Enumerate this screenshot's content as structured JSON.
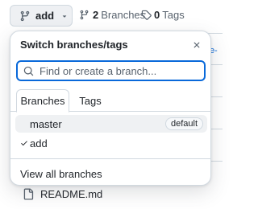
{
  "header": {
    "branch_button_label": "add",
    "branches_count": "2",
    "branches_word": "Branches",
    "tags_count": "0",
    "tags_word": "Tags",
    "bg_link_fragment": "ive-"
  },
  "panel": {
    "title": "Switch branches/tags",
    "search": {
      "placeholder": "Find or create a branch...",
      "value": ""
    },
    "tabs": [
      {
        "label": "Branches",
        "active": true
      },
      {
        "label": "Tags",
        "active": false
      }
    ],
    "items": [
      {
        "name": "master",
        "badge": "default",
        "selected": false,
        "highlighted": true
      },
      {
        "name": "add",
        "badge": "",
        "selected": true,
        "highlighted": false
      }
    ],
    "view_all": "View all branches"
  },
  "file": {
    "name": "README.md"
  },
  "colors": {
    "accent": "#0969da",
    "border": "#d1d9e0",
    "muted": "#59636e",
    "text": "#1f2328"
  },
  "icons": [
    "git-branch-icon",
    "chevron-down-icon",
    "tag-icon",
    "close-icon",
    "search-icon",
    "check-icon",
    "file-icon"
  ]
}
